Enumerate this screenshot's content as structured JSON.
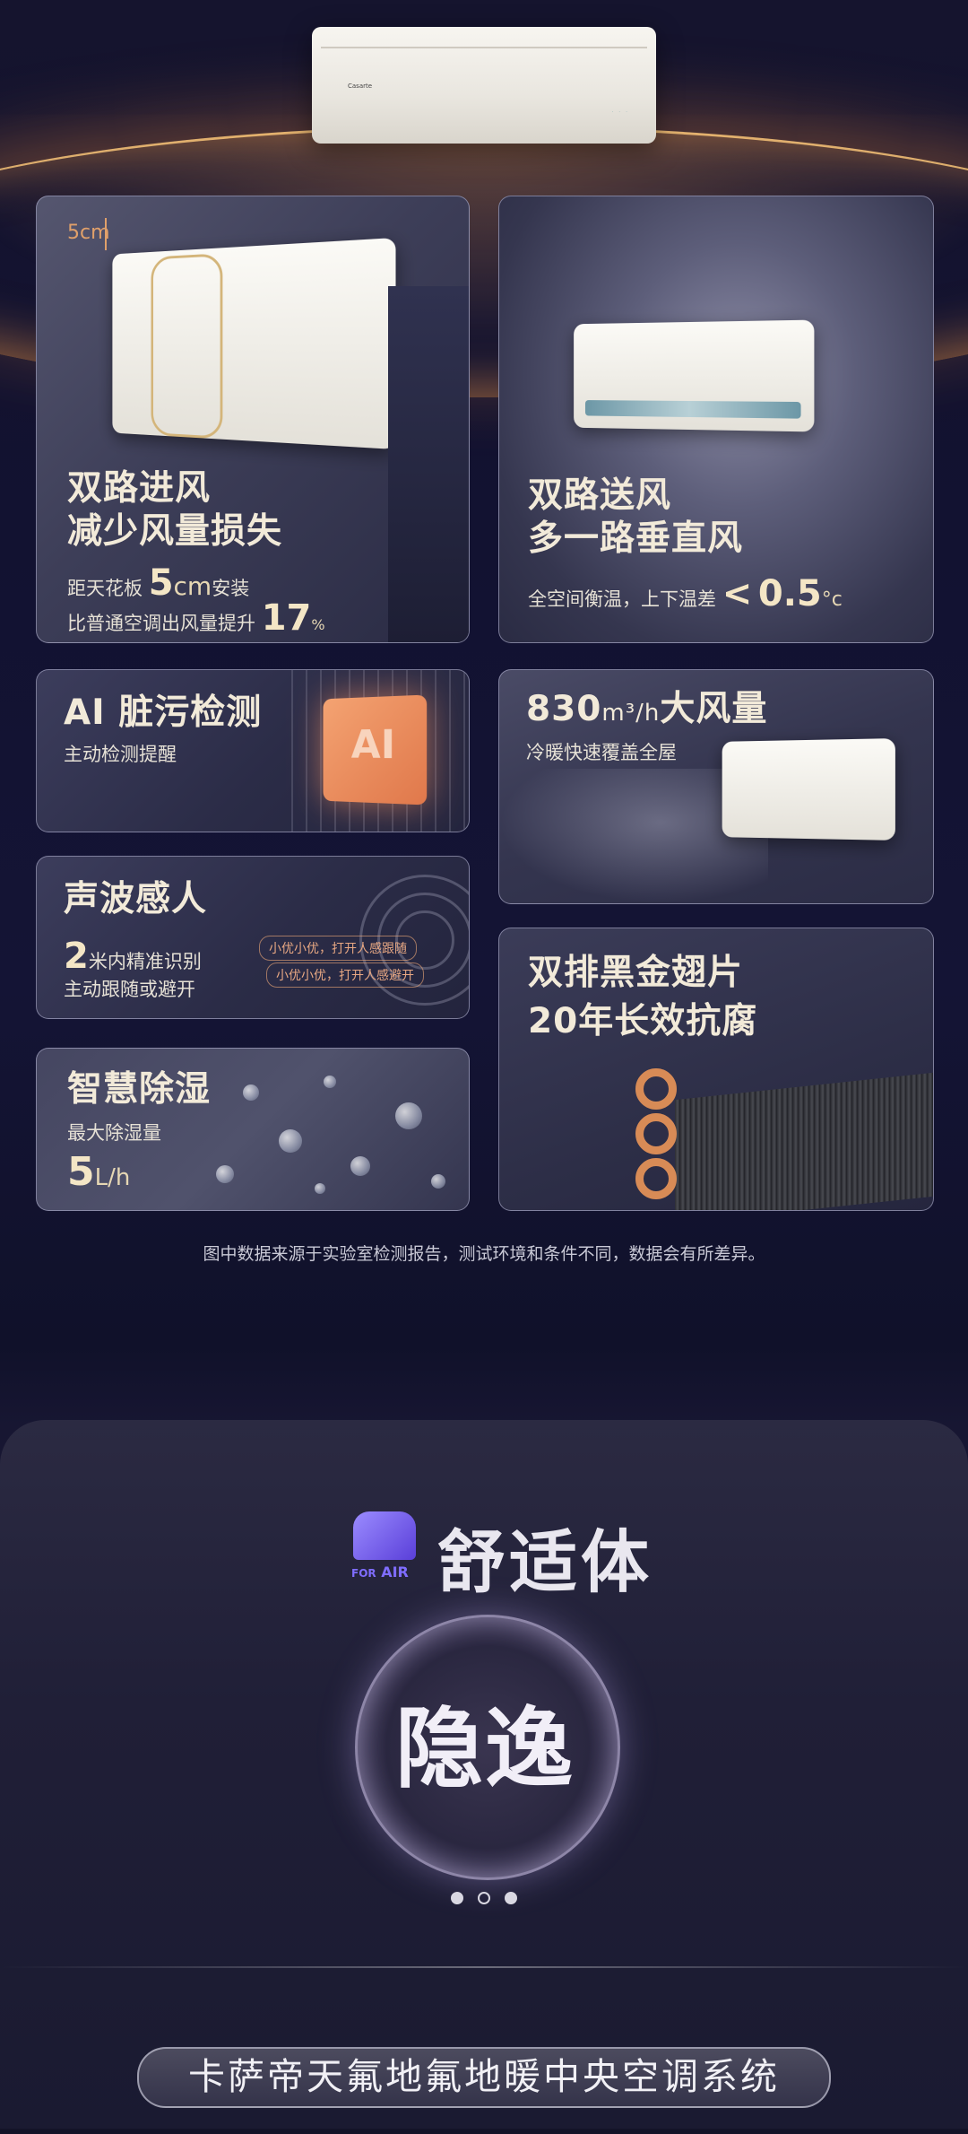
{
  "hero": {
    "brand": "Casarte",
    "lights": "· · ·"
  },
  "cards": {
    "dual_in": {
      "size_tag": "5cm",
      "title1": "双路进风",
      "title2": "减少风量损失",
      "line1_prefix": "距天花板",
      "line1_value": "5",
      "line1_unit": "cm",
      "line1_suffix": "安装",
      "line2_prefix": "比普通空调出风量提升",
      "line2_value": "17",
      "line2_unit": "%"
    },
    "dual_out": {
      "title1": "双路送风",
      "title2": "多一路垂直风",
      "line_prefix": "全空间衡温，上下温差",
      "line_sym": "<",
      "line_value": "0.5",
      "line_unit": "°c"
    },
    "ai_dirt": {
      "title": "AI 脏污检测",
      "sub": "主动检测提醒",
      "chip": "AI"
    },
    "airflow": {
      "title_value": "830",
      "title_unit": "m³/h",
      "title_text": "大风量",
      "sub": "冷暖快速覆盖全屋"
    },
    "sonic": {
      "title": "声波感人",
      "value": "2",
      "line1": "米内精准识别",
      "line2": "主动跟随或避开",
      "bubble1": "小优小优，打开人感跟随",
      "bubble2": "小优小优，打开人感避开"
    },
    "fins": {
      "title1": "双排黑金翅片",
      "title2": "20年长效抗腐"
    },
    "dehumid": {
      "title": "智慧除湿",
      "sub": "最大除湿量",
      "value": "5",
      "unit": "L/h"
    }
  },
  "note": "图中数据来源于实验室检测报告，测试环境和条件不同，数据会有所差异。",
  "comfort": {
    "logo_for": "FOR",
    "logo_air": "AIR",
    "title": "舒适体",
    "feature": "隐逸",
    "active_slide": 1,
    "slide_count": 3
  },
  "footer": {
    "system_label": "卡萨帝天氟地氟地暖中央空调系统"
  }
}
